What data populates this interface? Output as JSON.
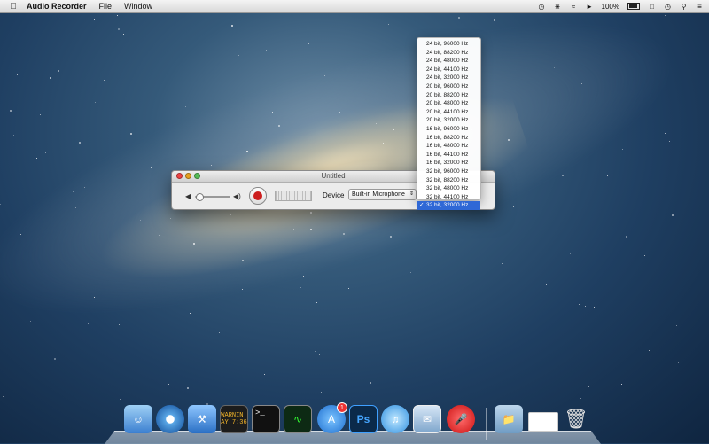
{
  "menubar": {
    "apple_icon": "apple-icon",
    "app_name": "Audio Recorder",
    "items": [
      "File",
      "Window"
    ],
    "battery": "100%"
  },
  "window": {
    "title": "Untitled",
    "device_label": "Device",
    "device_value": "Built-in Microphone",
    "volume_level": 0.1,
    "record_color": "#cc1e1e"
  },
  "format_menu": {
    "options": [
      "24 bit, 96000 Hz",
      "24 bit, 88200 Hz",
      "24 bit, 48000 Hz",
      "24 bit, 44100 Hz",
      "24 bit, 32000 Hz",
      "20 bit, 96000 Hz",
      "20 bit, 88200 Hz",
      "20 bit, 48000 Hz",
      "20 bit, 44100 Hz",
      "20 bit, 32000 Hz",
      "16 bit, 96000 Hz",
      "16 bit, 88200 Hz",
      "16 bit, 48000 Hz",
      "16 bit, 44100 Hz",
      "16 bit, 32000 Hz",
      "32 bit, 96000 Hz",
      "32 bit, 88200 Hz",
      "32 bit, 48000 Hz",
      "32 bit, 44100 Hz",
      "32 bit, 32000 Hz"
    ],
    "selected": "32 bit, 32000 Hz",
    "check": "✓",
    "highlight_color": "#2f68d6"
  },
  "dock": {
    "terminal_text": [
      "WARNIN",
      "AY 7:36"
    ],
    "app_store_badge": "1",
    "photoshop_label": "Ps"
  }
}
